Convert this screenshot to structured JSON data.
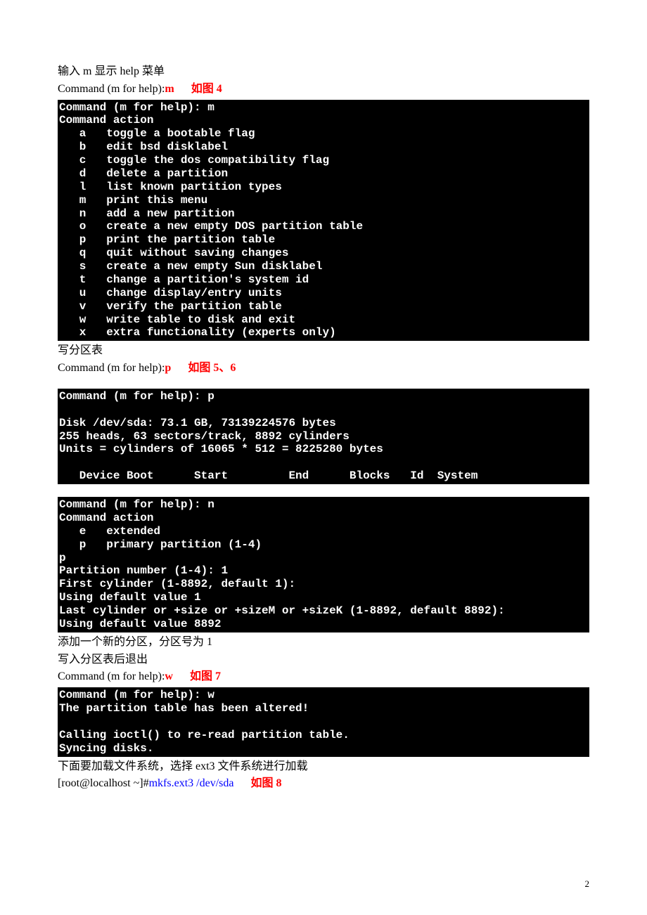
{
  "t0": "输入 m 显示 help 菜单",
  "t1a": "Command (m for help):",
  "t1b": "m",
  "t1c": "如图 4",
  "term1": "Command (m for help): m\nCommand action\n   a   toggle a bootable flag\n   b   edit bsd disklabel\n   c   toggle the dos compatibility flag\n   d   delete a partition\n   l   list known partition types\n   m   print this menu\n   n   add a new partition\n   o   create a new empty DOS partition table\n   p   print the partition table\n   q   quit without saving changes\n   s   create a new empty Sun disklabel\n   t   change a partition's system id\n   u   change display/entry units\n   v   verify the partition table\n   w   write table to disk and exit\n   x   extra functionality (experts only)",
  "t2": "写分区表",
  "t3a": "Command (m for help):",
  "t3b": "p",
  "t3c": "如图 5、6",
  "term2": "Command (m for help): p\n\nDisk /dev/sda: 73.1 GB, 73139224576 bytes\n255 heads, 63 sectors/track, 8892 cylinders\nUnits = cylinders of 16065 * 512 = 8225280 bytes\n\n   Device Boot      Start         End      Blocks   Id  System",
  "term3": "Command (m for help): n\nCommand action\n   e   extended\n   p   primary partition (1-4)\np\nPartition number (1-4): 1\nFirst cylinder (1-8892, default 1):\nUsing default value 1\nLast cylinder or +size or +sizeM or +sizeK (1-8892, default 8892):\nUsing default value 8892",
  "t4": "添加一个新的分区，分区号为 1",
  "t5": "写入分区表后退出",
  "t6a": "Command (m for help):",
  "t6b": "w",
  "t6c": "如图 7",
  "term4": "Command (m for help): w\nThe partition table has been altered!\n\nCalling ioctl() to re-read partition table.\nSyncing disks.",
  "t7": "下面要加载文件系统，选择 ext3 文件系统进行加载",
  "t8a": "[root@localhost ~]#",
  "t8b": "mkfs.ext3 /dev/sda",
  "t8c": "如图 8",
  "pageNum": "2"
}
